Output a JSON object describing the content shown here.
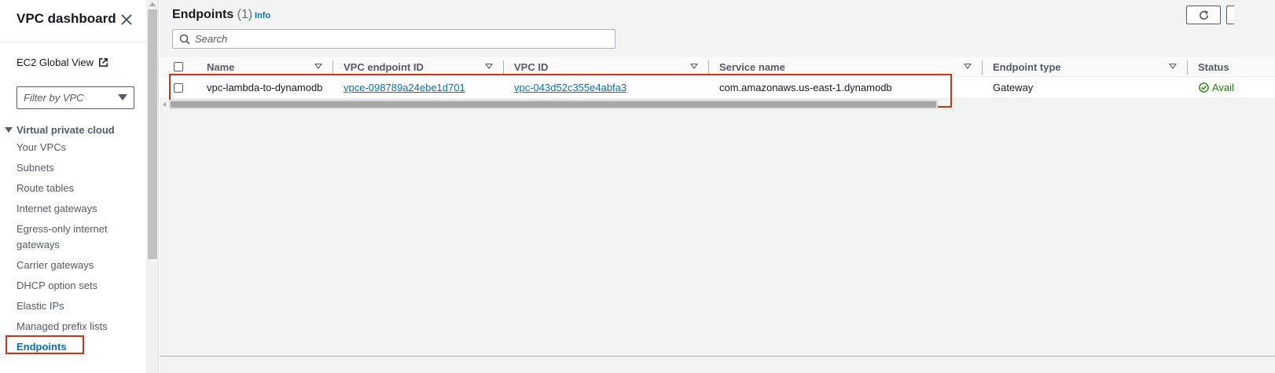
{
  "sidebar": {
    "title": "VPC dashboard",
    "global_view": "EC2 Global View",
    "filter_placeholder": "Filter by VPC",
    "section_label": "Virtual private cloud",
    "items": [
      {
        "label": "Your VPCs"
      },
      {
        "label": "Subnets"
      },
      {
        "label": "Route tables"
      },
      {
        "label": "Internet gateways"
      },
      {
        "label": "Egress-only internet gateways"
      },
      {
        "label": "Carrier gateways"
      },
      {
        "label": "DHCP option sets"
      },
      {
        "label": "Elastic IPs"
      },
      {
        "label": "Managed prefix lists"
      },
      {
        "label": "Endpoints",
        "active": true
      }
    ]
  },
  "main": {
    "title": "Endpoints",
    "count": "(1)",
    "info_label": "Info",
    "search_placeholder": "Search",
    "columns": [
      "Name",
      "VPC endpoint ID",
      "VPC ID",
      "Service name",
      "Endpoint type",
      "Status"
    ],
    "rows": [
      {
        "name": "vpc-lambda-to-dynamodb",
        "endpoint_id": "vpce-098789a24ebe1d701",
        "vpc_id": "vpc-043d52c355e4abfa3",
        "service_name": "com.amazonaws.us-east-1.dynamodb",
        "endpoint_type": "Gateway",
        "status": "Avail"
      }
    ]
  },
  "colors": {
    "link": "#0073bb",
    "highlight": "#d13212",
    "success": "#1d8102"
  },
  "icons": {
    "close": "close-icon",
    "external": "external-link-icon",
    "refresh": "refresh-icon",
    "search": "search-icon",
    "status": "success-check-icon"
  }
}
